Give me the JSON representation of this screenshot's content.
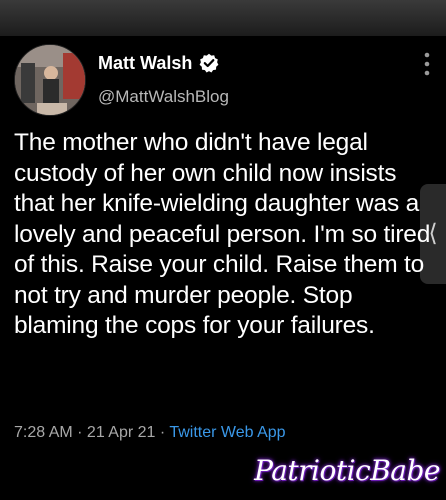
{
  "author": {
    "name": "Matt Walsh",
    "handle": "@MattWalshBlog",
    "verified": true
  },
  "tweet": {
    "text": "The mother who didn't have legal custody of her own child now insists that her knife-wielding daughter was a lovely and peaceful person. I'm so tired of this. Raise your child. Raise them to not try and murder people. Stop blaming the cops for your failures.",
    "time": "7:28 AM",
    "separator": " · ",
    "date": "21 Apr 21",
    "source": "Twitter Web App"
  },
  "watermark": "PatrioticBabe",
  "icons": {
    "verified": "verified-badge-icon",
    "more": "more-vertical-icon",
    "side_tab": "chevron-left-icon"
  },
  "colors": {
    "background": "#000000",
    "text": "#ffffff",
    "muted": "#a8a8a8",
    "link": "#3a98e8",
    "verified": "#ffffff"
  }
}
